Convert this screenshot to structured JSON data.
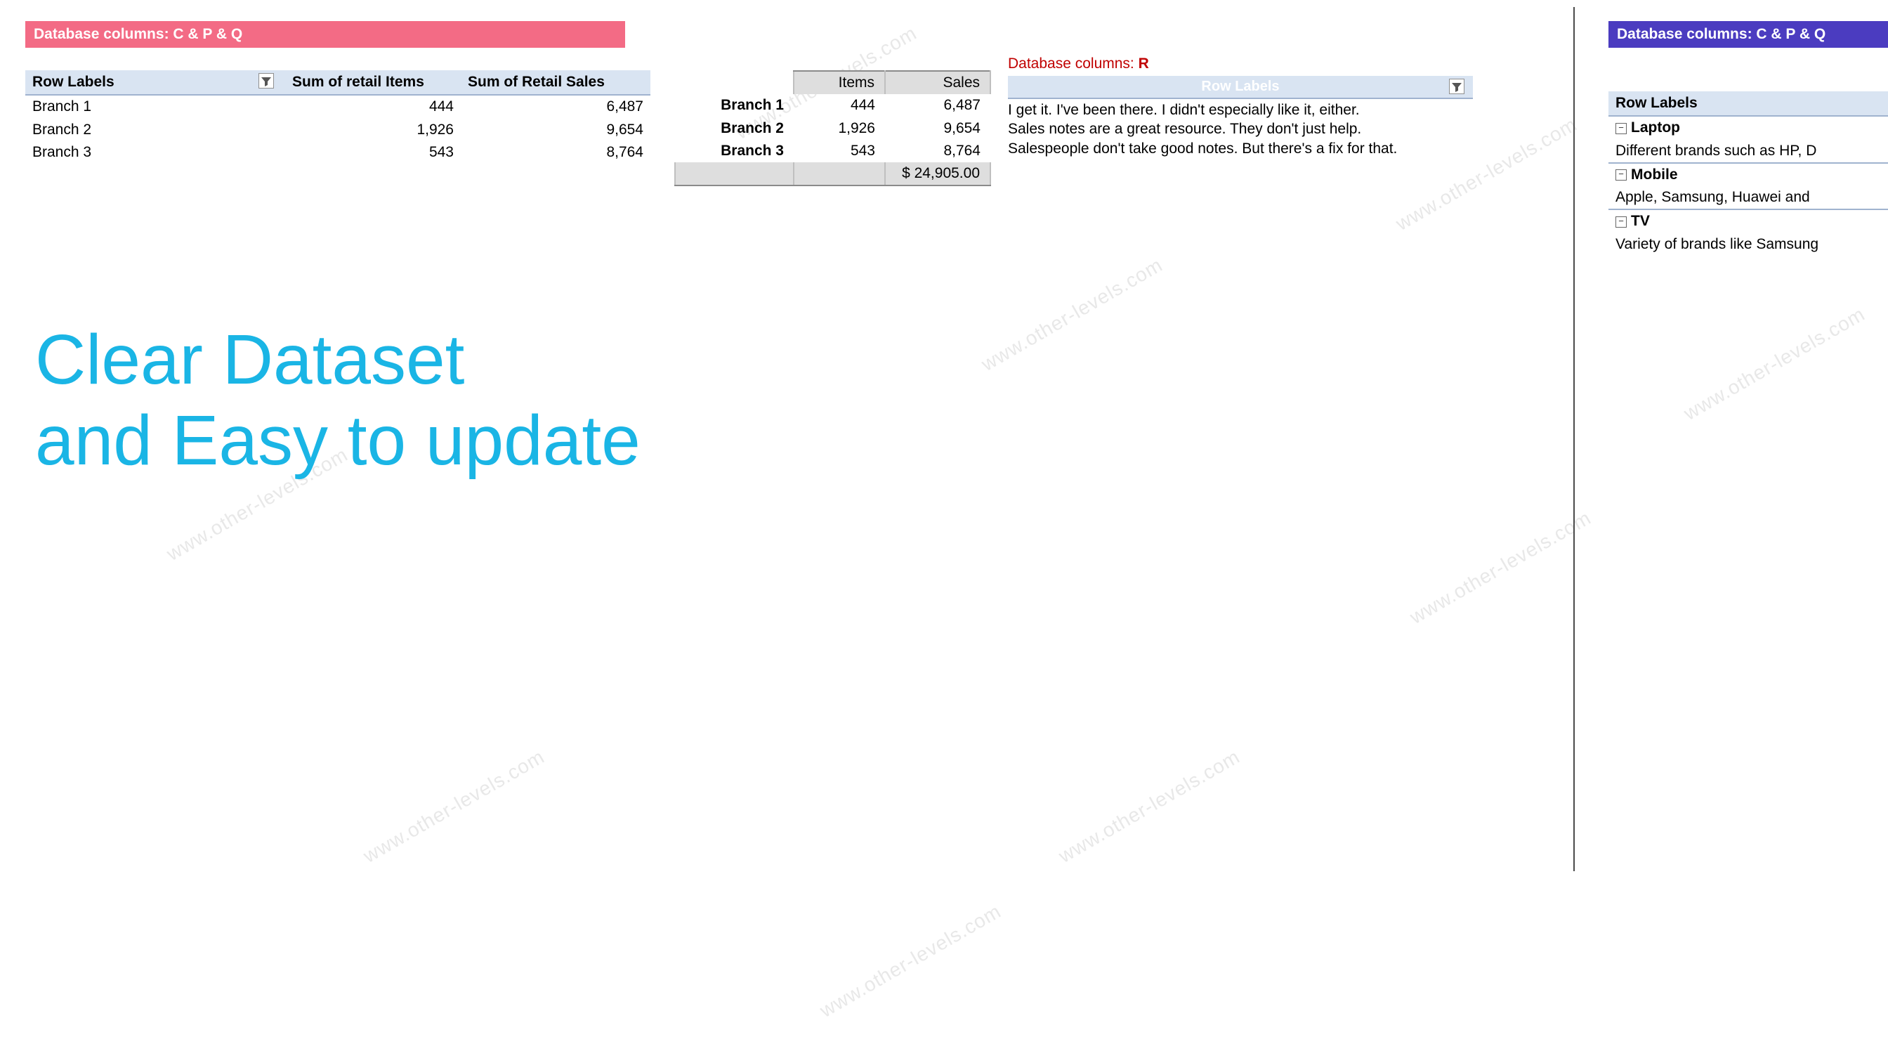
{
  "watermark": "www.other-levels.com",
  "banner_left": "Database columns: C & P & Q",
  "banner_right": "Database columns: C & P & Q",
  "pivot1": {
    "h1": "Row Labels",
    "h2": "Sum of retail Items",
    "h3": "Sum of Retail Sales",
    "rows": [
      {
        "label": "Branch 1",
        "items": "444",
        "sales": "6,487"
      },
      {
        "label": "Branch 2",
        "items": "1,926",
        "sales": "9,654"
      },
      {
        "label": "Branch 3",
        "items": "543",
        "sales": "8,764"
      }
    ]
  },
  "plain": {
    "h2": "Items",
    "h3": "Sales",
    "rows": [
      {
        "label": "Branch 1",
        "items": "444",
        "sales": "6,487"
      },
      {
        "label": "Branch 2",
        "items": "1,926",
        "sales": "9,654"
      },
      {
        "label": "Branch 3",
        "items": "543",
        "sales": "8,764"
      }
    ],
    "total": "$ 24,905.00"
  },
  "rsection": {
    "title": "Database columns: R",
    "hdr": "Row Labels",
    "lines": [
      "I get it. I've been there. I didn't especially like it, either.",
      "Sales notes are a great resource. They don't just help.",
      "Salespeople don't take good notes. But there's a fix for that."
    ]
  },
  "pivot3": {
    "h1": "Row Labels",
    "cats": [
      {
        "name": "Laptop",
        "desc": "Different brands such as HP, D"
      },
      {
        "name": "Mobile",
        "desc": "Apple, Samsung, Huawei and "
      },
      {
        "name": "TV",
        "desc": "Variety of brands like Samsung"
      }
    ]
  },
  "headline1": "Clear Dataset",
  "headline2": "and Easy to update"
}
